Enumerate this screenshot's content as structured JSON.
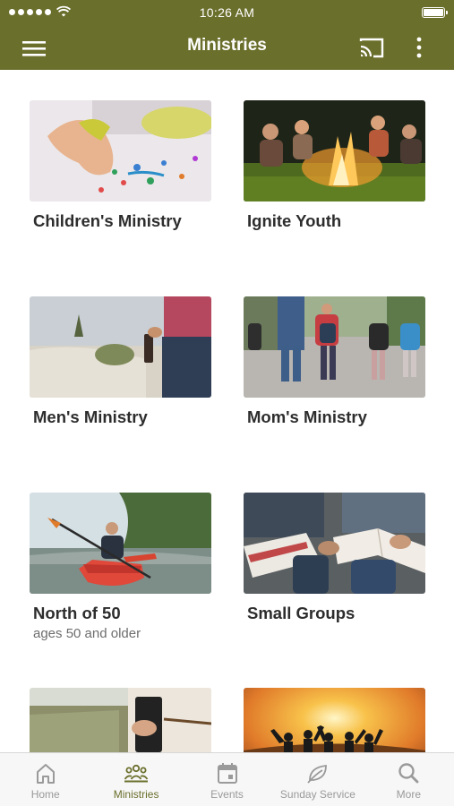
{
  "status_bar": {
    "time": "10:26 AM"
  },
  "header": {
    "title": "Ministries"
  },
  "ministries": [
    {
      "label": "Children's Ministry",
      "subtitle": ""
    },
    {
      "label": "Ignite Youth",
      "subtitle": ""
    },
    {
      "label": "Men's Ministry",
      "subtitle": ""
    },
    {
      "label": "Mom's Ministry",
      "subtitle": ""
    },
    {
      "label": "North of 50",
      "subtitle": "ages 50 and older"
    },
    {
      "label": "Small Groups",
      "subtitle": ""
    },
    {
      "label": "",
      "subtitle": ""
    },
    {
      "label": "",
      "subtitle": ""
    }
  ],
  "tabs": [
    {
      "label": "Home",
      "icon": "home-icon",
      "active": false
    },
    {
      "label": "Ministries",
      "icon": "group-icon",
      "active": true
    },
    {
      "label": "Events",
      "icon": "calendar-icon",
      "active": false
    },
    {
      "label": "Sunday Service",
      "icon": "leaf-icon",
      "active": false
    },
    {
      "label": "More",
      "icon": "search-icon",
      "active": false
    }
  ],
  "colors": {
    "brand": "#6b6f2c",
    "tab_inactive": "#9a9a9a"
  }
}
